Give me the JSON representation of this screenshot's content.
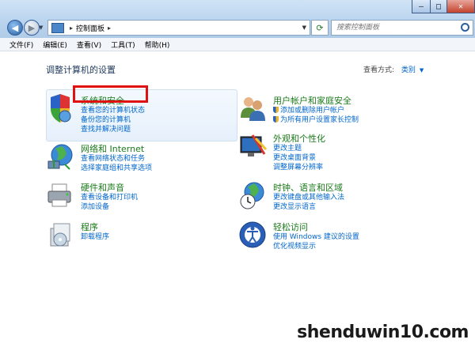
{
  "address": {
    "crumbs": [
      "控制面板"
    ],
    "search_placeholder": "搜索控制面板"
  },
  "menu": [
    "文件(F)",
    "编辑(E)",
    "查看(V)",
    "工具(T)",
    "帮助(H)"
  ],
  "page_title": "调整计算机的设置",
  "view_by": {
    "label": "查看方式:",
    "value": "类别"
  },
  "categories": [
    {
      "title": "系统和安全",
      "links": [
        "查看您的计算机状态",
        "备份您的计算机",
        "查找并解决问题"
      ]
    },
    {
      "title": "网络和 Internet",
      "links": [
        "查看网络状态和任务",
        "选择家庭组和共享选项"
      ]
    },
    {
      "title": "硬件和声音",
      "links": [
        "查看设备和打印机",
        "添加设备"
      ]
    },
    {
      "title": "程序",
      "links": [
        "卸载程序"
      ]
    },
    {
      "title": "用户帐户和家庭安全",
      "links": [
        "添加或删除用户帐户",
        "为所有用户设置家长控制"
      ]
    },
    {
      "title": "外观和个性化",
      "links": [
        "更改主题",
        "更改桌面背景",
        "调整屏幕分辨率"
      ]
    },
    {
      "title": "时钟、语言和区域",
      "links": [
        "更改键盘或其他输入法",
        "更改显示语言"
      ]
    },
    {
      "title": "轻松访问",
      "links": [
        "使用 Windows 建议的设置",
        "优化视频显示"
      ]
    }
  ],
  "watermark": "shenduwin10.com",
  "colors": {
    "accent_link": "#0066cc",
    "category_title": "#1a7a1a",
    "highlight_box": "#e01010"
  }
}
